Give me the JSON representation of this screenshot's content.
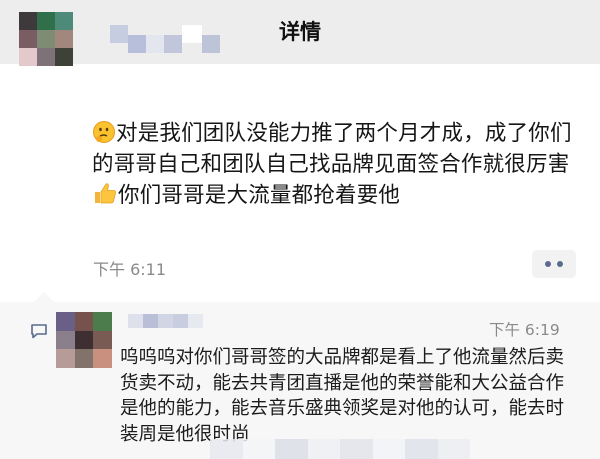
{
  "nav": {
    "title": "详情",
    "back_icon": "chevron-left-icon"
  },
  "post": {
    "text_before_emoji": "对是我们团队没能力推了两个月才成，成了你们的哥哥自己和团队自己找品牌见面签合作就很厉害",
    "text_after_emoji": "你们哥哥是大流量都抢着要他",
    "lead_emoji": "thinking-face-emoji",
    "inline_emoji": "thumbs-up-emoji",
    "time": "下午 6:11",
    "more_icon": "more-dots-icon"
  },
  "comment": {
    "time": "下午 6:19",
    "text": "呜呜呜对你们哥哥签的大品牌都是看上了他流量然后卖货卖不动，能去共青团直播是他的荣誉能和大公益合作是他的能力，能去音乐盛典领奖是对他的认可，能去时装周是他很时尚",
    "icon": "comment-icon"
  },
  "colors": {
    "navbar_bg": "#ededed",
    "comment_bg": "#f7f7f7",
    "time_text": "#8a8a8a",
    "more_dots": "#5b6b8c"
  }
}
